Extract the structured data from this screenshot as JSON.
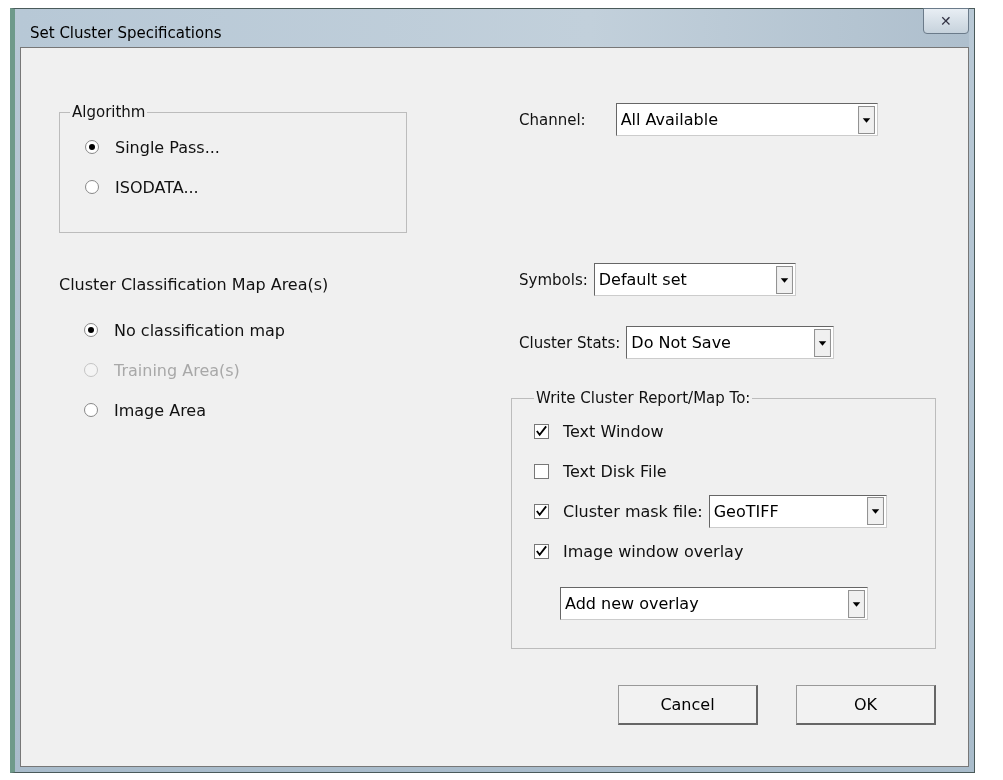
{
  "window": {
    "title": "Set Cluster Specifications",
    "close": "✕"
  },
  "algorithm": {
    "legend": "Algorithm",
    "options": [
      {
        "label": "Single Pass...",
        "selected": true,
        "disabled": false
      },
      {
        "label": "ISODATA...",
        "selected": false,
        "disabled": false
      }
    ]
  },
  "map_area": {
    "label": "Cluster Classification Map Area(s)",
    "options": [
      {
        "label": "No classification map",
        "selected": true,
        "disabled": false
      },
      {
        "label": "Training Area(s)",
        "selected": false,
        "disabled": true
      },
      {
        "label": "Image Area",
        "selected": false,
        "disabled": false
      }
    ]
  },
  "channel": {
    "label": "Channel:",
    "value": "All Available"
  },
  "symbols": {
    "label": "Symbols:",
    "value": "Default set"
  },
  "cluster_stats": {
    "label": "Cluster Stats:",
    "value": "Do Not Save"
  },
  "report": {
    "legend": "Write Cluster Report/Map To:",
    "options": [
      {
        "label": "Text Window",
        "checked": true
      },
      {
        "label": "Text Disk File",
        "checked": false
      },
      {
        "label": "Cluster mask file:",
        "checked": true,
        "format": "GeoTIFF"
      },
      {
        "label": "Image window overlay",
        "checked": true
      }
    ],
    "overlay": "Add new overlay"
  },
  "buttons": [
    "Cancel",
    "OK"
  ]
}
